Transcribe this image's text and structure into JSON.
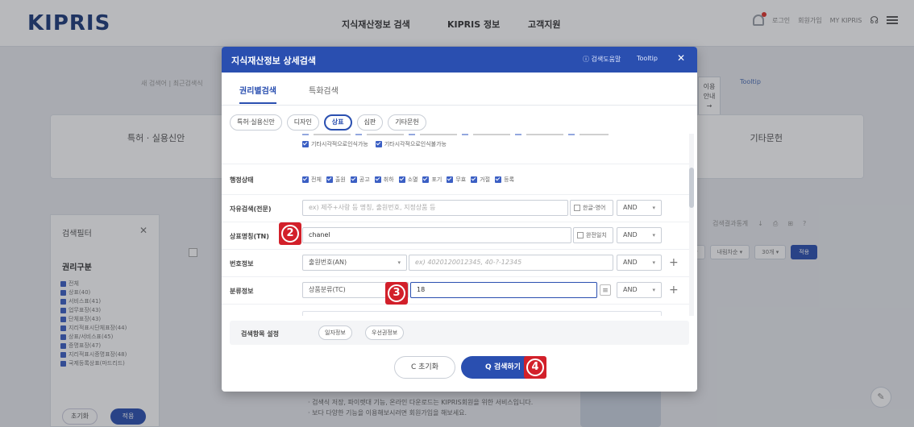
{
  "header": {
    "logo": "KIPRIS",
    "nav": [
      "지식재산정보 검색",
      "KIPRIS 정보",
      "고객지원"
    ],
    "util": [
      "로그인",
      "회원가입",
      "MY KIPRIS"
    ]
  },
  "background": {
    "breadcrumb": "새 검색어  |  최근검색식",
    "tooltip": "Tooltip",
    "side_guide": [
      "이용",
      "안내",
      "→"
    ],
    "categories": {
      "left": "특허 · 실용신안",
      "right": "기타문헌"
    },
    "filter": {
      "title": "검색필터",
      "subtitle": "권리구분",
      "items": [
        "전체",
        "상표(40)",
        "서비스표(41)",
        "업무표장(43)",
        "단체표장(43)",
        "지리적표시단체표장(44)",
        "상표/서비스표(45)",
        "증명표장(47)",
        "지리적표시증명표장(48)",
        "국제등록상표(마드리드)"
      ],
      "reset": "초기화",
      "apply": "적용"
    },
    "toolbar": [
      "검색결과통계",
      "↓",
      "⎙",
      "⊞",
      "?"
    ],
    "sort": [
      "정렬 ▾",
      "내림차순 ▾",
      "30개 ▾"
    ],
    "sort_apply": "적용",
    "notes": [
      "· 검색식 저장, 파이렛대 기능, 온라인 다운로드는 KIPRIS회원을 위한 서비스입니다.",
      "· 보다 다양한 기능을 이용해보시려면 회원가입을 해보세요."
    ]
  },
  "modal": {
    "title": "지식재산정보 상세검색",
    "help": "ⓘ 검색도움말",
    "tooltip": "Tooltip",
    "close": "✕",
    "tabs": [
      "권리별검색",
      "특화검색"
    ],
    "rights": [
      "특허·실용신안",
      "디자인",
      "상표",
      "심판",
      "기타문헌"
    ],
    "rights_selected": "상표",
    "partial_top_options": [
      "기타시각적으로인식가능",
      "기타시각적으로인식불가능"
    ],
    "status": {
      "label": "행정상태",
      "options": [
        "전체",
        "출원",
        "공고",
        "취하",
        "소멸",
        "포기",
        "무효",
        "거절",
        "등록"
      ]
    },
    "free_search": {
      "label": "자유검색(전문)",
      "placeholder": "ex) 제주+사랑 등 명칭, 출원번호, 지정상품 등",
      "option": "한글-영어",
      "operator": "AND"
    },
    "trademark_name": {
      "label": "상표명칭(TN)",
      "value": "chanel",
      "option": "완전일치",
      "operator": "AND"
    },
    "number_info": {
      "label": "번호정보",
      "select": "출원번호(AN)",
      "placeholder": "ex) 4020120012345, 40-?-12345",
      "operator": "AND"
    },
    "class_info": {
      "label": "분류정보",
      "select": "상품분류(TC)",
      "value": "18",
      "operator": "AND"
    },
    "options_section": {
      "title": "검색항목 설정",
      "buttons": [
        "일자정보",
        "우선권정보"
      ]
    },
    "reset_button": "C 초기화",
    "search_button": "Q 검색하기"
  },
  "markers": [
    "2",
    "3",
    "4"
  ]
}
